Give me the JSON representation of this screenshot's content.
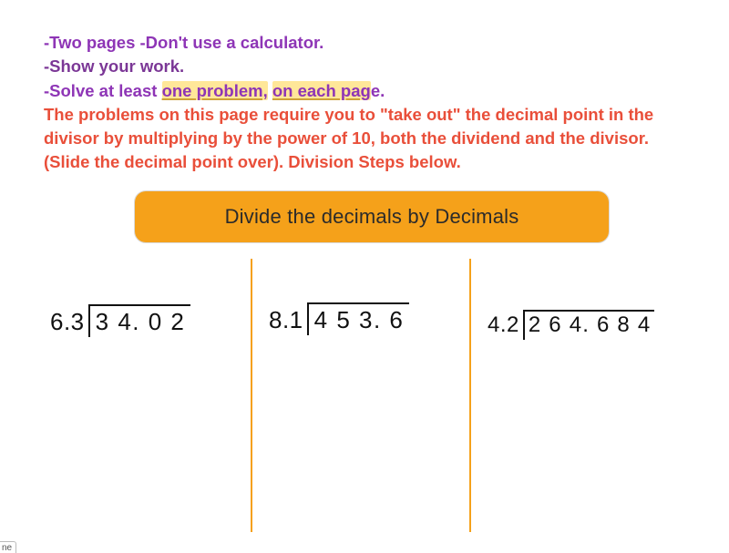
{
  "instructions": {
    "line1_a": "-Two pages -Don't use a calculator.",
    "line2": "-Show your work.",
    "line3_a": "-Solve at least ",
    "line3_hl1": "one problem,",
    "line3_mid": " ",
    "line3_hl2": "on each pag",
    "line3_b": "e.",
    "red": "The problems on this page require you to \"take out\" the decimal point in the divisor by multiplying by the power of 10, both the dividend and the divisor. (Slide the decimal point over).  Division Steps below."
  },
  "title": "Divide the decimals by Decimals",
  "problems": [
    {
      "divisor": "6.3",
      "dividend": "3 4. 0 2"
    },
    {
      "divisor": "8.1",
      "dividend": "4 5 3. 6"
    },
    {
      "divisor": "4.2",
      "dividend": "2 6 4. 6 8 4"
    }
  ],
  "corner_tab": "ne"
}
